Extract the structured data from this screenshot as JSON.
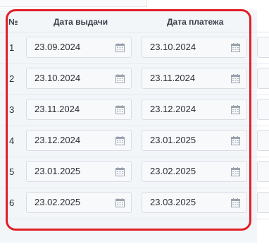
{
  "header": {
    "col_number": "№",
    "col_issue_date": "Дата выдачи",
    "col_payment_date": "Дата платежа"
  },
  "rows": [
    {
      "number": "1",
      "issue_date": "23.09.2024",
      "payment_date": "23.10.2024"
    },
    {
      "number": "2",
      "issue_date": "23.10.2024",
      "payment_date": "23.11.2024"
    },
    {
      "number": "3",
      "issue_date": "23.11.2024",
      "payment_date": "23.12.2024"
    },
    {
      "number": "4",
      "issue_date": "23.12.2024",
      "payment_date": "23.01.2025"
    },
    {
      "number": "5",
      "issue_date": "23.01.2025",
      "payment_date": "23.02.2025"
    },
    {
      "number": "6",
      "issue_date": "23.02.2025",
      "payment_date": "23.03.2025"
    }
  ],
  "icons": {
    "date_picker": "calendar-icon"
  },
  "colors": {
    "highlight": "#e01f26",
    "table_bg": "#f3f6f9",
    "field_bg": "#f8f9fb"
  }
}
